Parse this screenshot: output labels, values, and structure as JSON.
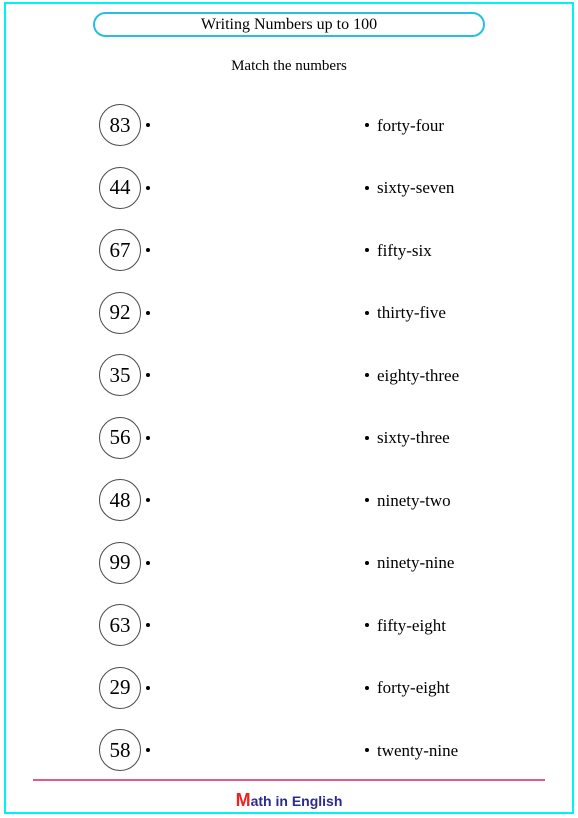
{
  "worksheet": {
    "title": "Writing Numbers up to 100",
    "instruction": "Match the numbers",
    "colors": {
      "page_border": "#00f2f2",
      "title_border": "#27bfe0",
      "footer_rule": "#e05a8c",
      "logo_m": "#ee2222",
      "logo_text": "#2b2b8f",
      "circle_stroke": "#4a4a4a"
    }
  },
  "rows": [
    {
      "number": "83",
      "word": "forty-four"
    },
    {
      "number": "44",
      "word": "sixty-seven"
    },
    {
      "number": "67",
      "word": "fifty-six"
    },
    {
      "number": "92",
      "word": "thirty-five"
    },
    {
      "number": "35",
      "word": "eighty-three"
    },
    {
      "number": "56",
      "word": "sixty-three"
    },
    {
      "number": "48",
      "word": "ninety-two"
    },
    {
      "number": "99",
      "word": "ninety-nine"
    },
    {
      "number": "63",
      "word": "fifty-eight"
    },
    {
      "number": "29",
      "word": "forty-eight"
    },
    {
      "number": "58",
      "word": "twenty-nine"
    }
  ],
  "footer": {
    "logo_first_letter": "M",
    "logo_rest": "ath in English"
  }
}
